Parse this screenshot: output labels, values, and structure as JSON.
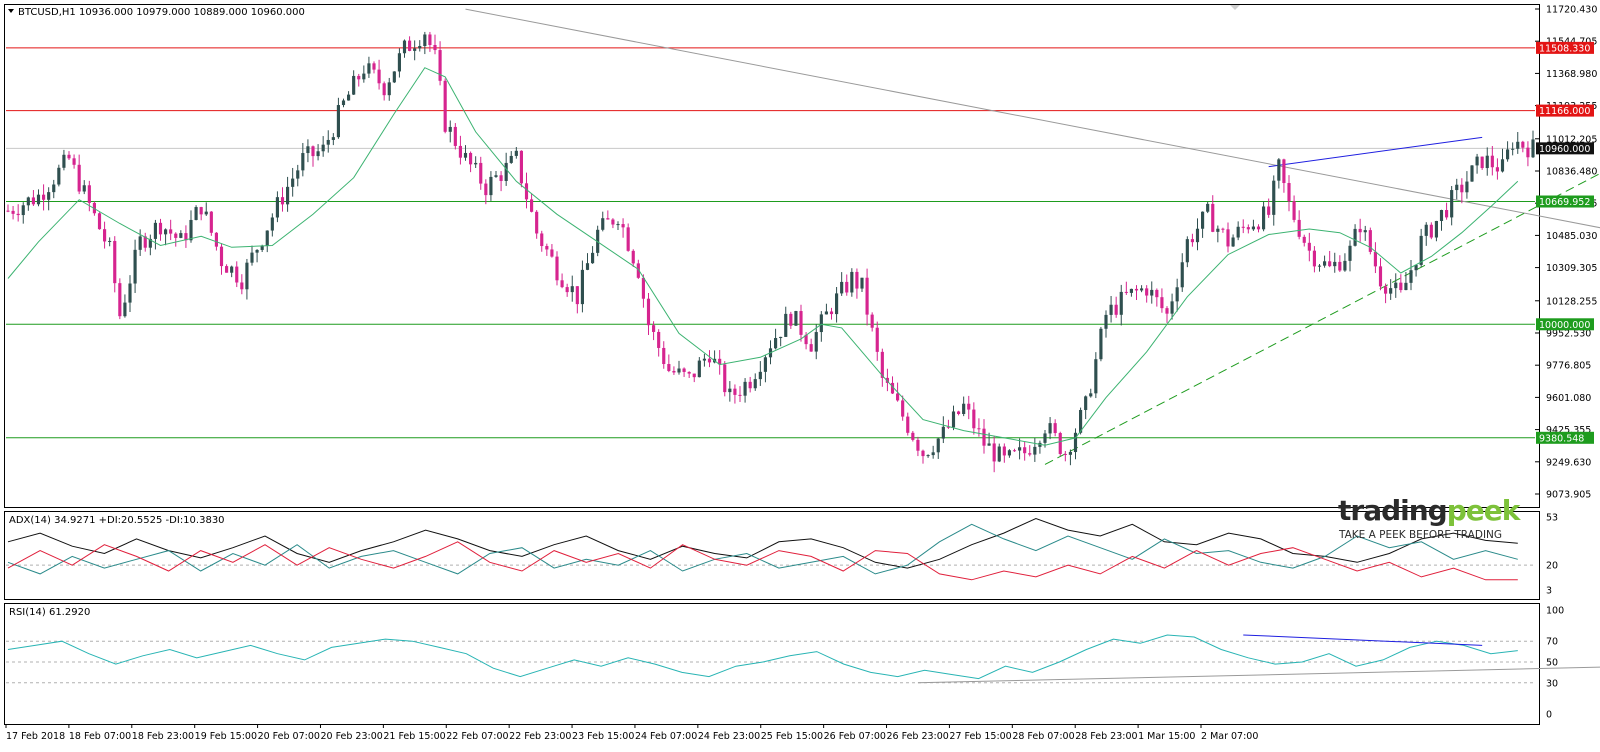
{
  "header": {
    "symbol": "BTCUSD,H1",
    "ohlc": "10936.000 10979.000 10889.000 10960.000"
  },
  "colors": {
    "bull": "#2f4f4f",
    "bear": "#d6248f",
    "ma": "#3cb371",
    "resistance": "#e31414",
    "support": "#1e9c1e",
    "trendline": "#9a9a9a",
    "divergence": "#1f1fe0",
    "adx": "#111111",
    "plus_di": "#2a8a8a",
    "minus_di": "#e0203c",
    "rsi": "#28b4b4",
    "current": "#111111"
  },
  "chart_data": [
    {
      "type": "candlestick",
      "pane": "price",
      "ylim": [
        9073.905,
        11720.43
      ],
      "x_labels": [
        "17 Feb 2018",
        "18 Feb 07:00",
        "18 Feb 23:00",
        "19 Feb 15:00",
        "20 Feb 07:00",
        "20 Feb 23:00",
        "21 Feb 15:00",
        "22 Feb 07:00",
        "22 Feb 23:00",
        "23 Feb 15:00",
        "24 Feb 07:00",
        "24 Feb 23:00",
        "25 Feb 15:00",
        "26 Feb 07:00",
        "26 Feb 23:00",
        "27 Feb 15:00",
        "28 Feb 07:00",
        "28 Feb 23:00",
        "1 Mar 15:00",
        "2 Mar 07:00"
      ],
      "y_ticks": [
        "11720.430",
        "11544.705",
        "11368.980",
        "11193.255",
        "11012.205",
        "10836.480",
        "10660.755",
        "10485.030",
        "10309.305",
        "10128.255",
        "9952.530",
        "9776.805",
        "9601.080",
        "9425.355",
        "9249.630",
        "9073.905"
      ],
      "level_labels": [
        {
          "value": 11508.33,
          "text": "11508.330",
          "kind": "resistance"
        },
        {
          "value": 11166.0,
          "text": "11166.000",
          "kind": "resistance"
        },
        {
          "value": 10960.0,
          "text": "10960.000",
          "kind": "current"
        },
        {
          "value": 10669.952,
          "text": "10669.952",
          "kind": "support"
        },
        {
          "value": 10000.0,
          "text": "10000.000",
          "kind": "support"
        },
        {
          "value": 9380.548,
          "text": "9380.548",
          "kind": "support"
        }
      ],
      "close_path": [
        [
          0,
          10620
        ],
        [
          6,
          10700
        ],
        [
          12,
          10900
        ],
        [
          16,
          10650
        ],
        [
          20,
          10400
        ],
        [
          22,
          10050
        ],
        [
          26,
          10450
        ],
        [
          30,
          10550
        ],
        [
          34,
          10450
        ],
        [
          38,
          10650
        ],
        [
          42,
          10350
        ],
        [
          46,
          10250
        ],
        [
          50,
          10480
        ],
        [
          54,
          10700
        ],
        [
          58,
          10900
        ],
        [
          62,
          10950
        ],
        [
          66,
          11200
        ],
        [
          70,
          11400
        ],
        [
          74,
          11300
        ],
        [
          78,
          11500
        ],
        [
          82,
          11600
        ],
        [
          84,
          11450
        ],
        [
          86,
          11100
        ],
        [
          90,
          10900
        ],
        [
          94,
          10750
        ],
        [
          98,
          10850
        ],
        [
          100,
          10900
        ],
        [
          104,
          10500
        ],
        [
          108,
          10300
        ],
        [
          112,
          10150
        ],
        [
          116,
          10500
        ],
        [
          120,
          10600
        ],
        [
          124,
          10300
        ],
        [
          126,
          10000
        ],
        [
          130,
          9750
        ],
        [
          134,
          9700
        ],
        [
          138,
          9850
        ],
        [
          142,
          9600
        ],
        [
          146,
          9700
        ],
        [
          150,
          9900
        ],
        [
          154,
          10050
        ],
        [
          158,
          9900
        ],
        [
          162,
          10100
        ],
        [
          166,
          10250
        ],
        [
          168,
          10200
        ],
        [
          172,
          9700
        ],
        [
          176,
          9500
        ],
        [
          180,
          9300
        ],
        [
          184,
          9400
        ],
        [
          188,
          9550
        ],
        [
          192,
          9350
        ],
        [
          196,
          9250
        ],
        [
          200,
          9300
        ],
        [
          204,
          9450
        ],
        [
          208,
          9300
        ],
        [
          212,
          9550
        ],
        [
          216,
          10050
        ],
        [
          220,
          10150
        ],
        [
          224,
          10200
        ],
        [
          228,
          10050
        ],
        [
          232,
          10450
        ],
        [
          236,
          10600
        ],
        [
          240,
          10450
        ],
        [
          244,
          10550
        ],
        [
          248,
          10600
        ],
        [
          250,
          10850
        ],
        [
          252,
          10650
        ],
        [
          256,
          10400
        ],
        [
          260,
          10300
        ],
        [
          264,
          10400
        ],
        [
          266,
          10550
        ],
        [
          270,
          10250
        ],
        [
          274,
          10150
        ],
        [
          278,
          10450
        ],
        [
          282,
          10600
        ],
        [
          286,
          10750
        ],
        [
          290,
          10900
        ],
        [
          294,
          10850
        ],
        [
          296,
          11000
        ],
        [
          300,
          10960
        ]
      ],
      "moving_average_path": [
        [
          0,
          10250
        ],
        [
          6,
          10450
        ],
        [
          14,
          10680
        ],
        [
          22,
          10550
        ],
        [
          30,
          10430
        ],
        [
          38,
          10480
        ],
        [
          44,
          10420
        ],
        [
          52,
          10430
        ],
        [
          60,
          10600
        ],
        [
          68,
          10800
        ],
        [
          76,
          11150
        ],
        [
          82,
          11400
        ],
        [
          86,
          11350
        ],
        [
          92,
          11050
        ],
        [
          100,
          10780
        ],
        [
          108,
          10600
        ],
        [
          116,
          10450
        ],
        [
          124,
          10300
        ],
        [
          132,
          9950
        ],
        [
          140,
          9780
        ],
        [
          148,
          9820
        ],
        [
          156,
          9920
        ],
        [
          160,
          10000
        ],
        [
          164,
          9980
        ],
        [
          172,
          9720
        ],
        [
          180,
          9480
        ],
        [
          188,
          9420
        ],
        [
          196,
          9380
        ],
        [
          204,
          9340
        ],
        [
          210,
          9380
        ],
        [
          216,
          9600
        ],
        [
          224,
          9850
        ],
        [
          232,
          10150
        ],
        [
          240,
          10380
        ],
        [
          248,
          10490
        ],
        [
          256,
          10520
        ],
        [
          262,
          10500
        ],
        [
          268,
          10420
        ],
        [
          274,
          10280
        ],
        [
          280,
          10370
        ],
        [
          286,
          10500
        ],
        [
          292,
          10650
        ],
        [
          297,
          10780
        ]
      ],
      "trendlines": [
        {
          "name": "descending trendline",
          "points": [
            [
              90,
              11720
            ],
            [
              322,
              10480
            ]
          ]
        },
        {
          "name": "price peak divergence",
          "points": [
            [
              248,
              10860
            ],
            [
              290,
              11020
            ]
          ]
        },
        {
          "name": "ascending support",
          "points": [
            [
              204,
              9235
            ],
            [
              313,
              10820
            ]
          ],
          "dashed": true
        }
      ]
    },
    {
      "type": "line",
      "pane": "adx",
      "label": "ADX(14) 34.9271 +DI:20.5525 -DI:10.3830",
      "ylim": [
        3,
        53
      ],
      "y_ticks": [
        "53",
        "20",
        "3"
      ],
      "levels": [
        20
      ],
      "series": [
        {
          "name": "ADX",
          "role": "adx",
          "values": [
            36,
            42,
            33,
            28,
            38,
            30,
            25,
            32,
            40,
            28,
            22,
            30,
            36,
            44,
            38,
            30,
            26,
            34,
            40,
            30,
            24,
            33,
            28,
            25,
            36,
            38,
            32,
            22,
            18,
            24,
            34,
            42,
            52,
            44,
            40,
            48,
            36,
            34,
            42,
            38,
            28,
            26,
            22,
            28,
            38,
            42,
            37,
            35
          ]
        },
        {
          "name": "+DI",
          "role": "plus_di",
          "values": [
            22,
            14,
            26,
            18,
            24,
            30,
            16,
            28,
            20,
            34,
            18,
            26,
            30,
            22,
            14,
            28,
            32,
            18,
            24,
            20,
            30,
            16,
            24,
            28,
            18,
            22,
            26,
            14,
            20,
            36,
            48,
            38,
            30,
            40,
            32,
            24,
            38,
            28,
            30,
            22,
            18,
            26,
            40,
            32,
            36,
            24,
            30,
            24
          ]
        },
        {
          "name": "-DI",
          "role": "minus_di",
          "values": [
            18,
            30,
            20,
            34,
            26,
            16,
            30,
            22,
            34,
            20,
            32,
            24,
            18,
            26,
            36,
            22,
            16,
            30,
            22,
            28,
            18,
            34,
            24,
            20,
            30,
            26,
            16,
            30,
            28,
            14,
            10,
            16,
            12,
            20,
            14,
            26,
            18,
            30,
            20,
            28,
            32,
            24,
            16,
            22,
            12,
            18,
            10,
            10
          ]
        }
      ]
    },
    {
      "type": "line",
      "pane": "rsi",
      "label": "RSI(14) 61.2920",
      "ylim": [
        0,
        100
      ],
      "y_ticks": [
        "100",
        "70",
        "50",
        "30",
        "0"
      ],
      "levels": [
        70,
        50,
        30
      ],
      "series": [
        {
          "name": "RSI",
          "role": "rsi",
          "values": [
            62,
            66,
            70,
            58,
            48,
            56,
            62,
            54,
            60,
            66,
            58,
            52,
            64,
            68,
            72,
            70,
            64,
            58,
            44,
            36,
            44,
            52,
            46,
            54,
            48,
            40,
            36,
            46,
            50,
            56,
            60,
            48,
            40,
            36,
            42,
            38,
            34,
            46,
            40,
            50,
            62,
            72,
            68,
            76,
            74,
            62,
            54,
            48,
            50,
            58,
            46,
            52,
            64,
            70,
            66,
            58,
            61
          ]
        }
      ],
      "trendlines": [
        {
          "name": "RSI high trendline",
          "points": [
            [
              243,
              76
            ],
            [
              290,
              66
            ]
          ]
        },
        {
          "name": "RSI low trendline",
          "points": [
            [
              179,
              30
            ],
            [
              322,
              46
            ]
          ]
        }
      ]
    }
  ],
  "watermark": {
    "brand": "tradingpeek",
    "tagline": "TAKE A PEEK BEFORE TRADING"
  }
}
